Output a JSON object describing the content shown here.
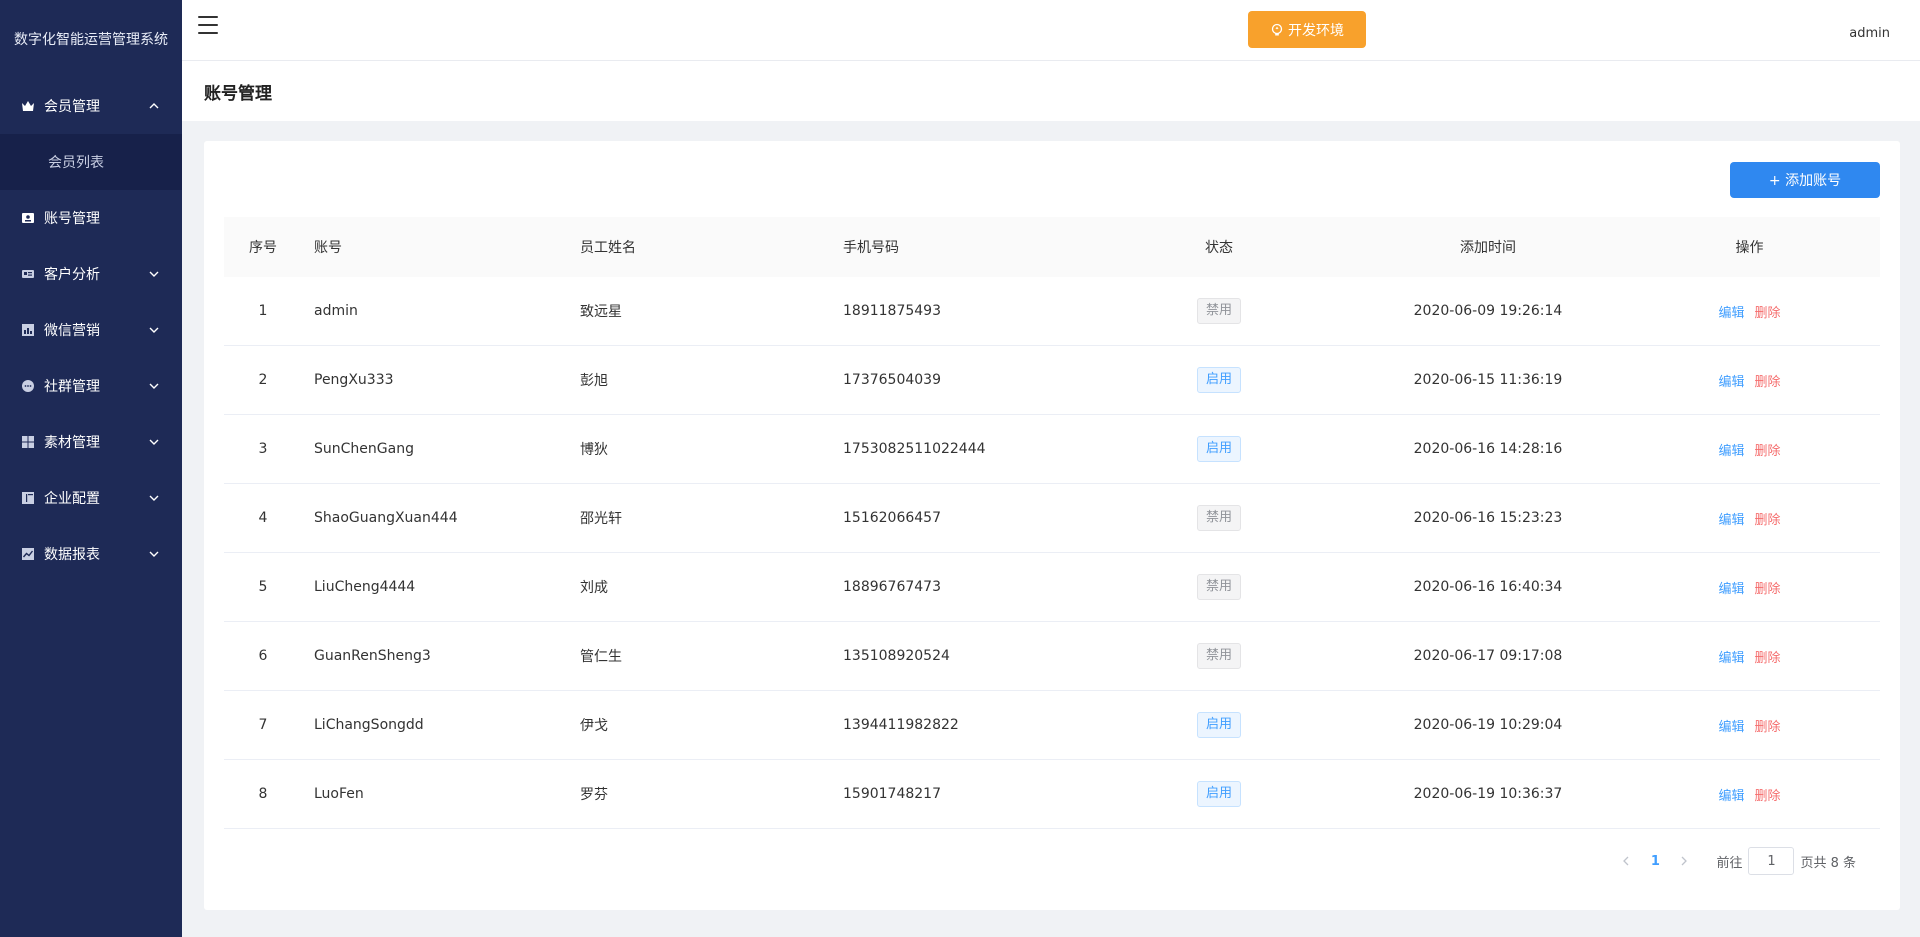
{
  "sidebar": {
    "brand": "数字化智能运营管理系统",
    "items": [
      {
        "label": "会员管理",
        "icon": "crown-icon",
        "expanded": true
      },
      {
        "label": "会员列表"
      },
      {
        "label": "账号管理",
        "icon": "id-card-icon"
      },
      {
        "label": "客户分析",
        "icon": "profile-card-icon"
      },
      {
        "label": "微信营销",
        "icon": "bar-chart-icon"
      },
      {
        "label": "社群管理",
        "icon": "chat-bubble-icon"
      },
      {
        "label": "素材管理",
        "icon": "grid-icon"
      },
      {
        "label": "企业配置",
        "icon": "layout-icon"
      },
      {
        "label": "数据报表",
        "icon": "line-chart-icon"
      }
    ]
  },
  "header": {
    "env_label": "开发环境",
    "user": "admin"
  },
  "page": {
    "title": "账号管理",
    "add_label": "+ 添加账号"
  },
  "table": {
    "columns": [
      "序号",
      "账号",
      "员工姓名",
      "手机号码",
      "状态",
      "添加时间",
      "操作"
    ],
    "rows": [
      {
        "idx": "1",
        "account": "admin",
        "name": "致远星",
        "phone": "18911875493",
        "status": "禁用",
        "time": "2020-06-09 19:26:14"
      },
      {
        "idx": "2",
        "account": "PengXu333",
        "name": "彭旭",
        "phone": "17376504039",
        "status": "启用",
        "time": "2020-06-15 11:36:19"
      },
      {
        "idx": "3",
        "account": "SunChenGang",
        "name": "博狄",
        "phone": "1753082511022444",
        "status": "启用",
        "time": "2020-06-16 14:28:16"
      },
      {
        "idx": "4",
        "account": "ShaoGuangXuan444",
        "name": "邵光轩",
        "phone": "15162066457",
        "status": "禁用",
        "time": "2020-06-16 15:23:23"
      },
      {
        "idx": "5",
        "account": "LiuCheng4444",
        "name": "刘成",
        "phone": "18896767473",
        "status": "禁用",
        "time": "2020-06-16 16:40:34"
      },
      {
        "idx": "6",
        "account": "GuanRenSheng3",
        "name": "管仁生",
        "phone": "135108920524",
        "status": "禁用",
        "time": "2020-06-17 09:17:08"
      },
      {
        "idx": "7",
        "account": "LiChangSongdd",
        "name": "伊戈",
        "phone": "1394411982822",
        "status": "启用",
        "time": "2020-06-19 10:29:04"
      },
      {
        "idx": "8",
        "account": "LuoFen",
        "name": "罗芬",
        "phone": "15901748217",
        "status": "启用",
        "time": "2020-06-19 10:36:37"
      }
    ],
    "edit_label": "编辑",
    "delete_label": "删除"
  },
  "pagination": {
    "current": "1",
    "goto_label": "前往",
    "goto_value": "1",
    "total_label": "页共 8 条"
  }
}
